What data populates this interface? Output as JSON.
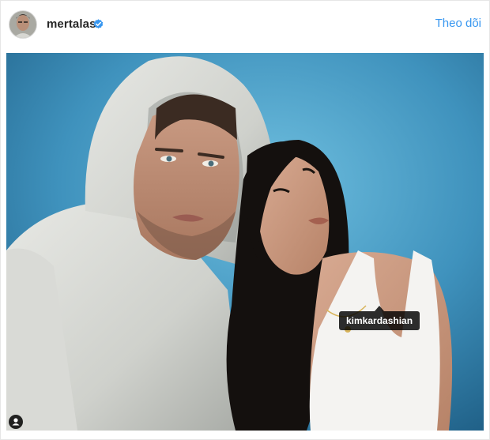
{
  "post": {
    "username": "mertalas",
    "verified": true,
    "follow_label": "Theo dõi",
    "tag": {
      "username": "kimkardashian"
    }
  },
  "colors": {
    "link_blue": "#3897f0",
    "verified_blue": "#3897f0",
    "text_dark": "#262626",
    "photo_background": "#3d8fb8"
  },
  "icons": {
    "verified": "verified-badge-icon",
    "user_tags": "user-tag-icon"
  }
}
